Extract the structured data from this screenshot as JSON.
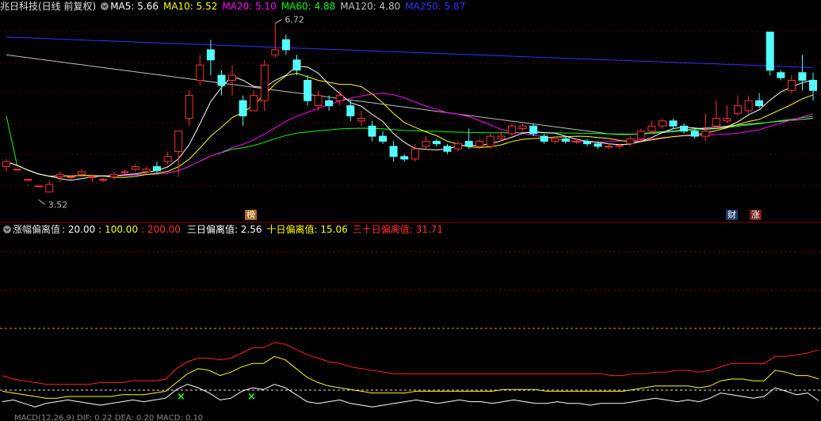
{
  "header": {
    "stock": "兆日科技(日线 前复权)",
    "ma": [
      {
        "label": "MA5:",
        "value": "5.66",
        "color": "#ffffff"
      },
      {
        "label": "MA10:",
        "value": "5.52",
        "color": "#ffff00"
      },
      {
        "label": "MA20:",
        "value": "5.10",
        "color": "#ff00ff"
      },
      {
        "label": "MA60:",
        "value": "4.88",
        "color": "#00ff00"
      },
      {
        "label": "MA120:",
        "value": "4.80",
        "color": "#c0c0c0"
      },
      {
        "label": "MA250:",
        "value": "5.87",
        "color": "#3333ff"
      }
    ]
  },
  "indicator": {
    "name": "涨幅偏离值",
    "params": [
      {
        "text": ": 20.00",
        "color": "#ffffff"
      },
      {
        "text": ": 100.00",
        "color": "#ffff00"
      },
      {
        "text": ": 200.00",
        "color": "#ff3333"
      }
    ],
    "values": [
      {
        "label": "三日偏离值:",
        "value": "2.56",
        "color": "#ffffff"
      },
      {
        "label": "十日偏离值:",
        "value": "15.06",
        "color": "#ffff00"
      },
      {
        "label": "三十日偏离值:",
        "value": "31.71",
        "color": "#ff3333"
      }
    ]
  },
  "markers": {
    "high": "6.72",
    "low": "3.52",
    "bang": "榜",
    "cai": "财",
    "zhang": "涨"
  },
  "bottom_hint": "MACD(12,26,9) DIF: 0.22 DEA: 0.20 MACD: 0.10",
  "colors": {
    "up": "#ff3232",
    "down": "#54ffff",
    "ma5": "#ffffff",
    "ma10": "#ffff00",
    "ma20": "#ff00ff",
    "ma60": "#00ff00",
    "ma120": "#c0c0c0",
    "ma250": "#3333ff"
  },
  "chart_data": [
    {
      "type": "candlestick",
      "series": [
        {
          "name": "K",
          "ohlc": [
            [
              3.9,
              4.0,
              3.8,
              4.05
            ],
            [
              3.85,
              3.85,
              3.6,
              3.6
            ],
            [
              3.65,
              3.65,
              3.52,
              3.55
            ],
            [
              3.52,
              3.52,
              3.25,
              3.25
            ],
            [
              3.4,
              3.55,
              3.4,
              3.62
            ],
            [
              3.7,
              3.75,
              3.6,
              3.8
            ],
            [
              3.7,
              3.7,
              3.65,
              3.72
            ],
            [
              3.75,
              3.8,
              3.7,
              3.85
            ],
            [
              3.7,
              3.7,
              3.6,
              3.75
            ],
            [
              3.65,
              3.65,
              3.6,
              3.68
            ],
            [
              3.7,
              3.75,
              3.65,
              3.8
            ],
            [
              3.8,
              3.8,
              3.75,
              3.85
            ],
            [
              3.85,
              3.9,
              3.8,
              3.95
            ],
            [
              3.8,
              3.85,
              3.75,
              3.9
            ],
            [
              3.9,
              3.82,
              3.75,
              4.0
            ],
            [
              4.0,
              4.1,
              3.95,
              4.2
            ],
            [
              4.2,
              4.6,
              3.7,
              4.6
            ],
            [
              4.85,
              5.3,
              4.7,
              5.4
            ],
            [
              5.6,
              5.9,
              5.5,
              6.1
            ],
            [
              6.2,
              6.0,
              5.7,
              6.4
            ],
            [
              5.7,
              5.5,
              5.3,
              5.8
            ],
            [
              5.6,
              5.7,
              5.3,
              5.9
            ],
            [
              5.2,
              4.9,
              4.7,
              5.3
            ],
            [
              5.0,
              5.3,
              5.1,
              5.4
            ],
            [
              5.2,
              5.9,
              5.0,
              6.0
            ],
            [
              6.1,
              6.2,
              6.05,
              6.72
            ],
            [
              6.4,
              6.2,
              6.1,
              6.5
            ],
            [
              6.0,
              5.8,
              5.7,
              6.1
            ],
            [
              5.6,
              5.2,
              5.1,
              5.7
            ],
            [
              5.1,
              5.3,
              5.0,
              5.4
            ],
            [
              5.2,
              5.1,
              5.0,
              5.3
            ],
            [
              5.2,
              5.3,
              5.1,
              5.4
            ],
            [
              5.1,
              4.9,
              4.8,
              5.2
            ],
            [
              4.8,
              4.85,
              4.7,
              5.0
            ],
            [
              4.7,
              4.5,
              4.4,
              4.8
            ],
            [
              4.5,
              4.4,
              4.35,
              4.6
            ],
            [
              4.3,
              4.1,
              4.0,
              4.4
            ],
            [
              4.1,
              4.05,
              4.0,
              4.15
            ],
            [
              4.05,
              4.25,
              4.0,
              4.35
            ],
            [
              4.3,
              4.4,
              4.25,
              4.5
            ],
            [
              4.4,
              4.35,
              4.3,
              4.45
            ],
            [
              4.3,
              4.2,
              4.15,
              4.35
            ],
            [
              4.25,
              4.35,
              4.2,
              4.4
            ],
            [
              4.4,
              4.3,
              4.25,
              4.65
            ],
            [
              4.3,
              4.4,
              4.25,
              4.45
            ],
            [
              4.3,
              4.5,
              4.25,
              4.55
            ],
            [
              4.45,
              4.5,
              4.4,
              4.6
            ],
            [
              4.55,
              4.7,
              4.5,
              4.75
            ],
            [
              4.65,
              4.7,
              4.6,
              4.75
            ],
            [
              4.7,
              4.55,
              4.5,
              4.75
            ],
            [
              4.5,
              4.4,
              4.35,
              4.55
            ],
            [
              4.4,
              4.45,
              4.35,
              4.5
            ],
            [
              4.45,
              4.4,
              4.35,
              4.5
            ],
            [
              4.4,
              4.4,
              4.35,
              4.45
            ],
            [
              4.4,
              4.35,
              4.3,
              4.45
            ],
            [
              4.35,
              4.3,
              4.25,
              4.4
            ],
            [
              4.3,
              4.3,
              4.25,
              4.35
            ],
            [
              4.3,
              4.32,
              4.25,
              4.35
            ],
            [
              4.35,
              4.45,
              4.3,
              4.5
            ],
            [
              4.45,
              4.6,
              4.4,
              4.65
            ],
            [
              4.6,
              4.7,
              4.55,
              4.8
            ],
            [
              4.7,
              4.8,
              4.65,
              4.85
            ],
            [
              4.8,
              4.7,
              4.65,
              4.85
            ],
            [
              4.7,
              4.6,
              4.55,
              4.75
            ],
            [
              4.6,
              4.5,
              4.45,
              4.65
            ],
            [
              4.5,
              4.6,
              4.4,
              4.95
            ],
            [
              4.7,
              4.85,
              4.65,
              5.2
            ],
            [
              4.8,
              4.85,
              4.75,
              5.1
            ],
            [
              4.95,
              5.1,
              4.9,
              5.3
            ],
            [
              5.0,
              5.2,
              4.95,
              5.3
            ],
            [
              5.2,
              5.1,
              5.05,
              5.35
            ],
            [
              6.55,
              5.8,
              5.7,
              6.55
            ],
            [
              5.75,
              5.65,
              5.6,
              5.8
            ],
            [
              5.4,
              5.6,
              5.35,
              5.7
            ],
            [
              5.75,
              5.6,
              5.4,
              6.1
            ],
            [
              5.6,
              5.4,
              5.2,
              5.75
            ]
          ]
        }
      ],
      "ma_series": [
        "MA5",
        "MA10",
        "MA20",
        "MA60",
        "MA120",
        "MA250"
      ],
      "annotations": [
        "6.72",
        "3.52",
        "榜",
        "财",
        "涨"
      ]
    },
    {
      "type": "line",
      "series": [
        {
          "name": "三日偏离值",
          "values": [
            2,
            3,
            1,
            -1,
            1,
            2,
            3,
            2,
            1,
            0,
            1,
            2,
            3,
            2,
            3,
            4,
            9,
            12,
            10,
            7,
            3,
            4,
            8,
            10,
            9,
            12,
            10,
            6,
            2,
            1,
            2,
            3,
            1,
            0,
            -1,
            0,
            1,
            2,
            3,
            2,
            1,
            2,
            3,
            2,
            2,
            1,
            2,
            3,
            2,
            1,
            1,
            2,
            1,
            1,
            0,
            1,
            1,
            1,
            2,
            3,
            4,
            3,
            2,
            3,
            2,
            4,
            7,
            6,
            5,
            4,
            5,
            10,
            8,
            6,
            7,
            2.56
          ]
        },
        {
          "name": "十日偏离值",
          "values": [
            8,
            7,
            6,
            5,
            4,
            4,
            5,
            5,
            5,
            5,
            5,
            6,
            6,
            6,
            7,
            8,
            13,
            18,
            21,
            20,
            17,
            19,
            22,
            24,
            24,
            28,
            26,
            21,
            16,
            13,
            11,
            10,
            9,
            8,
            7,
            7,
            7,
            7,
            8,
            8,
            8,
            8,
            8,
            8,
            8,
            8,
            9,
            9,
            9,
            9,
            8,
            8,
            8,
            8,
            8,
            8,
            8,
            8,
            9,
            10,
            11,
            11,
            11,
            11,
            10,
            11,
            14,
            15,
            15,
            14,
            14,
            20,
            19,
            17,
            17,
            15.06
          ]
        },
        {
          "name": "三十日偏离值",
          "values": [
            17,
            15,
            14,
            13,
            12,
            12,
            12,
            12,
            12,
            13,
            13,
            13,
            14,
            14,
            14,
            15,
            21,
            25,
            27,
            27,
            26,
            27,
            30,
            33,
            33,
            36,
            35,
            32,
            29,
            27,
            25,
            24,
            22,
            21,
            20,
            19,
            18,
            18,
            18,
            18,
            18,
            18,
            18,
            18,
            18,
            18,
            18,
            18,
            18,
            18,
            18,
            18,
            18,
            18,
            18,
            18,
            17,
            17,
            18,
            18,
            19,
            19,
            20,
            20,
            19,
            20,
            22,
            24,
            24,
            24,
            24,
            28,
            28,
            29,
            30,
            31.71
          ]
        }
      ],
      "ylim": [
        0,
        100
      ],
      "reference_lines": [
        20,
        100,
        200
      ]
    }
  ]
}
